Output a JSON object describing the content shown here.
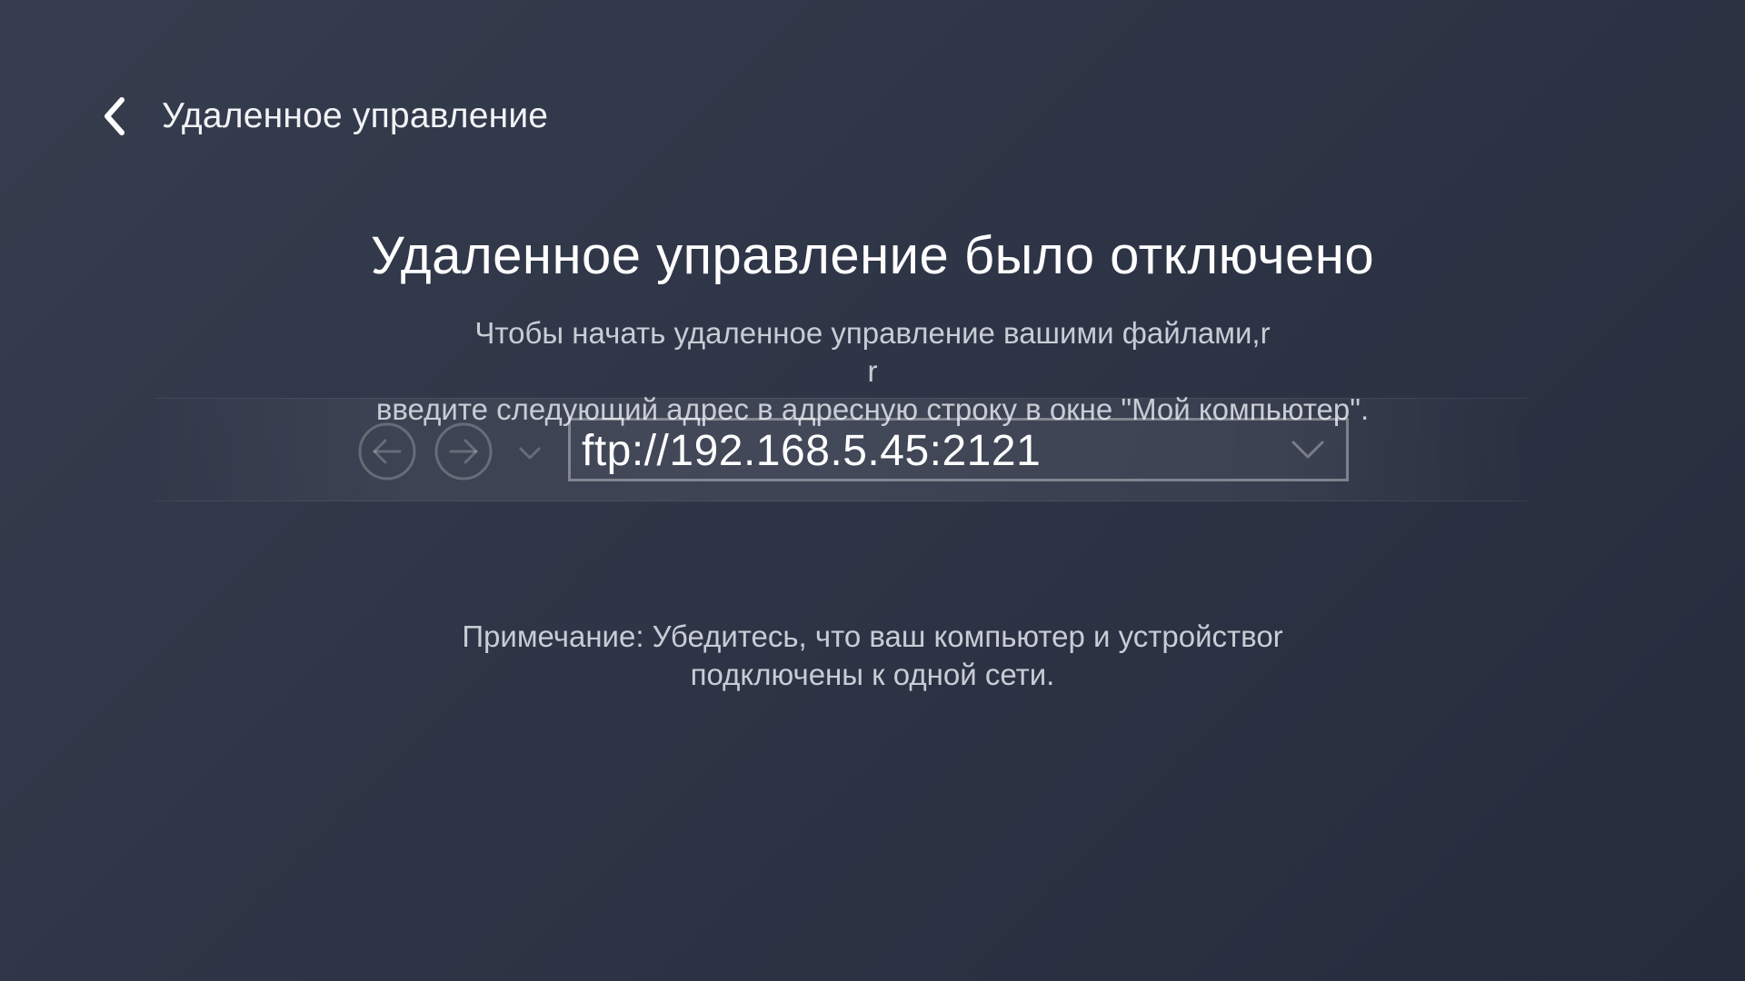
{
  "header": {
    "back_icon": "chevron-left-icon",
    "title": "Удаленное управление"
  },
  "main": {
    "title": "Удаленное управление было отключено",
    "instruction_lines": [
      "Чтобы начать удаленное управление вашими файлами,r",
      "r",
      "введите следующий адрес в адресную строку в окне \"Мой компьютер\"."
    ],
    "address_bar": {
      "back_icon": "arrow-left-circle-icon",
      "forward_icon": "arrow-right-circle-icon",
      "history_icon": "chevron-down-icon",
      "address": "ftp://192.168.5.45:2121",
      "dropdown_icon": "chevron-down-icon"
    },
    "note_lines": [
      "Примечание: Убедитесь, что ваш компьютер и устройствоr",
      "подключены к одной сети."
    ]
  },
  "colors": {
    "background_start": "#353d4e",
    "background_end": "#262c3c",
    "text_primary": "#ffffff",
    "text_secondary": "#c8ccd5"
  }
}
